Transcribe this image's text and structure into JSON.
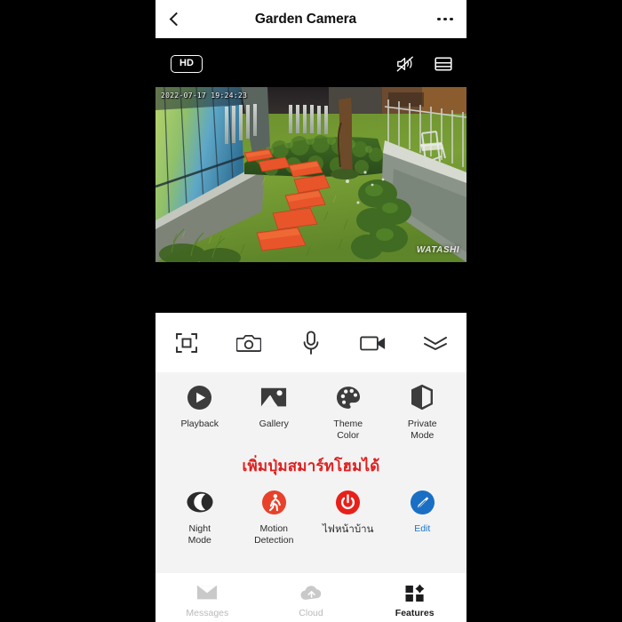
{
  "header": {
    "title": "Garden Camera",
    "back_icon": "chevron-left-icon",
    "more_icon": "more-options-icon"
  },
  "video": {
    "quality_badge": "HD",
    "mute_icon": "speaker-muted-icon",
    "split_screen_icon": "split-screen-icon",
    "timestamp": "2022-07-17 19:24:23",
    "watermark": "WATASHI"
  },
  "controls": [
    {
      "name": "ptz-fullscreen-button",
      "icon": "focus-frame-icon"
    },
    {
      "name": "snapshot-button",
      "icon": "camera-icon"
    },
    {
      "name": "talk-button",
      "icon": "microphone-icon"
    },
    {
      "name": "record-button",
      "icon": "video-camera-icon"
    },
    {
      "name": "expand-button",
      "icon": "double-chevron-down-icon"
    }
  ],
  "features": {
    "row1": [
      {
        "label": "Playback",
        "icon": "play-circle-icon",
        "color": "#3c3c3c"
      },
      {
        "label": "Gallery",
        "icon": "image-icon",
        "color": "#3c3c3c"
      },
      {
        "label": "Theme\nColor",
        "label_line1": "Theme",
        "label_line2": "Color",
        "icon": "palette-icon",
        "color": "#3c3c3c"
      },
      {
        "label": "Private\nMode",
        "label_line1": "Private",
        "label_line2": "Mode",
        "icon": "shield-icon",
        "color": "#3c3c3c"
      }
    ],
    "promo_text": "เพิ่มปุ่มสมาร์ทโฮมได้",
    "promo_color": "#e01f1f",
    "row2": [
      {
        "label_line1": "Night",
        "label_line2": "Mode",
        "icon": "moon-icon",
        "color": "#3c3c3c"
      },
      {
        "label_line1": "Motion",
        "label_line2": "Detection",
        "icon": "motion-detection-icon",
        "color": "#e8412a"
      },
      {
        "label_line1": "ไฟหน้าบ้าน",
        "label_line2": "",
        "icon": "power-icon",
        "color": "#e8201a"
      },
      {
        "label_line1": "Edit",
        "label_line2": "",
        "icon": "pencil-circle-icon",
        "color": "#1a6fc4"
      }
    ]
  },
  "bottom_nav": [
    {
      "label": "Messages",
      "icon": "envelope-icon",
      "active": false
    },
    {
      "label": "Cloud",
      "icon": "cloud-icon",
      "active": false
    },
    {
      "label": "Features",
      "icon": "grid-icon",
      "active": true
    }
  ]
}
